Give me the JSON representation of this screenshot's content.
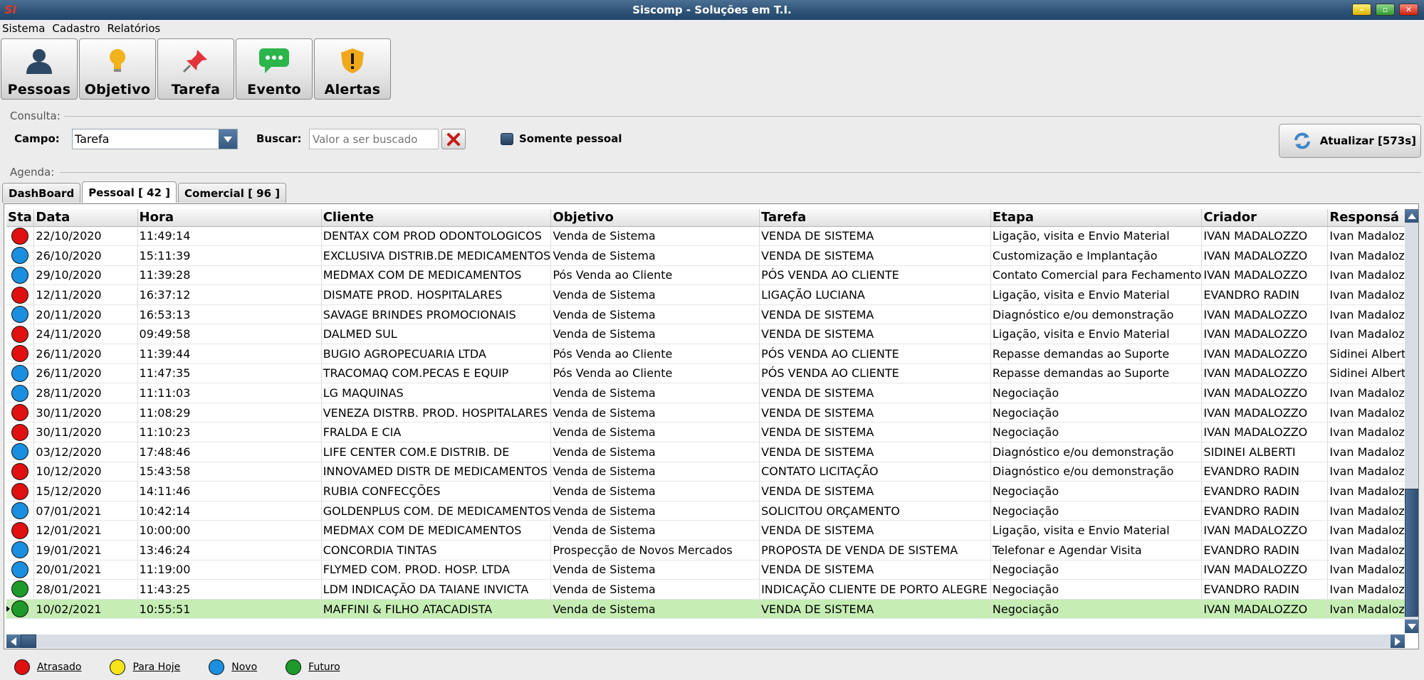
{
  "window": {
    "title": "Siscomp - Soluções em T.I."
  },
  "menu": [
    "Sistema",
    "Cadastro",
    "Relatórios"
  ],
  "toolbar": [
    {
      "label": "Pessoas",
      "icon": "person-icon"
    },
    {
      "label": "Objetivo",
      "icon": "lightbulb-icon"
    },
    {
      "label": "Tarefa",
      "icon": "pin-icon"
    },
    {
      "label": "Evento",
      "icon": "chat-bubble-icon"
    },
    {
      "label": "Alertas",
      "icon": "shield-alert-icon"
    }
  ],
  "consulta": {
    "group_label": "Consulta:",
    "campo_label": "Campo:",
    "campo_value": "Tarefa",
    "buscar_label": "Buscar:",
    "buscar_placeholder": "Valor a ser buscado",
    "somente_label": "Somente pessoal",
    "refresh_label": "Atualizar [573s]"
  },
  "agenda": {
    "group_label": "Agenda:",
    "tabs": [
      "DashBoard",
      "Pessoal  [ 42 ]",
      "Comercial  [ 96 ]"
    ],
    "active_tab": 1
  },
  "colors": {
    "red": "#e01010",
    "blue": "#1a8fe0",
    "green": "#1d9a2a",
    "yellow": "#f7e51a",
    "selected_row": "#c6eeb4"
  },
  "table": {
    "columns": [
      "Sta",
      "Data",
      "Hora",
      "Cliente",
      "Objetivo",
      "Tarefa",
      "Etapa",
      "Criador",
      "Responsá"
    ],
    "rows": [
      {
        "status": "red",
        "data": "22/10/2020",
        "hora": "11:49:14",
        "cliente": "DENTAX COM PROD ODONTOLOGICOS",
        "objetivo": "Venda de Sistema",
        "tarefa": "VENDA DE SISTEMA",
        "etapa": "Ligação,  visita e Envio Material",
        "criador": "IVAN MADALOZZO",
        "responsavel": "Ivan Madalozzo"
      },
      {
        "status": "blue",
        "data": "26/10/2020",
        "hora": "15:11:39",
        "cliente": "EXCLUSIVA DISTRIB.DE MEDICAMENTOS",
        "objetivo": "Venda de Sistema",
        "tarefa": "VENDA DE SISTEMA",
        "etapa": "Customização e Implantação",
        "criador": "IVAN MADALOZZO",
        "responsavel": "Ivan Madalozzo"
      },
      {
        "status": "blue",
        "data": "29/10/2020",
        "hora": "11:39:28",
        "cliente": "MEDMAX COM DE MEDICAMENTOS",
        "objetivo": "Pós Venda ao Cliente",
        "tarefa": "PÓS VENDA AO CLIENTE",
        "etapa": "Contato Comercial para Fechamento",
        "criador": "IVAN MADALOZZO",
        "responsavel": "Ivan Madalozzo"
      },
      {
        "status": "red",
        "data": "12/11/2020",
        "hora": "16:37:12",
        "cliente": "DISMATE PROD. HOSPITALARES",
        "objetivo": "Venda de Sistema",
        "tarefa": "LIGAÇÃO LUCIANA",
        "etapa": "Ligação,  visita e Envio Material",
        "criador": "EVANDRO RADIN",
        "responsavel": "Ivan Madalozzo"
      },
      {
        "status": "blue",
        "data": "20/11/2020",
        "hora": "16:53:13",
        "cliente": "SAVAGE BRINDES PROMOCIONAIS",
        "objetivo": "Venda de Sistema",
        "tarefa": "VENDA DE SISTEMA",
        "etapa": "Diagnóstico e/ou  demonstração",
        "criador": "IVAN MADALOZZO",
        "responsavel": "Ivan Madalozzo"
      },
      {
        "status": "red",
        "data": "24/11/2020",
        "hora": "09:49:58",
        "cliente": "DALMED SUL",
        "objetivo": "Venda de Sistema",
        "tarefa": "VENDA DE SISTEMA",
        "etapa": "Ligação,  visita e Envio Material",
        "criador": "IVAN MADALOZZO",
        "responsavel": "Ivan Madalozzo"
      },
      {
        "status": "red",
        "data": "26/11/2020",
        "hora": "11:39:44",
        "cliente": "BUGIO   AGROPECUARIA LTDA",
        "objetivo": "Pós Venda ao Cliente",
        "tarefa": "PÓS VENDA AO CLIENTE",
        "etapa": "Repasse demandas ao Suporte",
        "criador": "IVAN MADALOZZO",
        "responsavel": "Sidinei  Alberti"
      },
      {
        "status": "blue",
        "data": "26/11/2020",
        "hora": "11:47:35",
        "cliente": "TRACOMAQ    COM.PECAS E EQUIP",
        "objetivo": "Pós Venda ao Cliente",
        "tarefa": "PÓS VENDA AO CLIENTE",
        "etapa": "Repasse demandas ao Suporte",
        "criador": "IVAN MADALOZZO",
        "responsavel": "Sidinei  Alberti"
      },
      {
        "status": "blue",
        "data": "28/11/2020",
        "hora": "11:11:03",
        "cliente": "LG MAQUINAS",
        "objetivo": "Venda de Sistema",
        "tarefa": "VENDA DE SISTEMA",
        "etapa": "Negociação",
        "criador": "IVAN MADALOZZO",
        "responsavel": "Ivan Madalozzo"
      },
      {
        "status": "red",
        "data": "30/11/2020",
        "hora": "11:08:29",
        "cliente": "VENEZA DISTRB. PROD. HOSPITALARES",
        "objetivo": "Venda de Sistema",
        "tarefa": "VENDA DE SISTEMA",
        "etapa": "Negociação",
        "criador": "IVAN MADALOZZO",
        "responsavel": "Ivan Madalozzo"
      },
      {
        "status": "red",
        "data": "30/11/2020",
        "hora": "11:10:23",
        "cliente": "FRALDA E CIA",
        "objetivo": "Venda de Sistema",
        "tarefa": "VENDA DE SISTEMA",
        "etapa": "Negociação",
        "criador": "IVAN MADALOZZO",
        "responsavel": "Ivan Madalozzo"
      },
      {
        "status": "blue",
        "data": "03/12/2020",
        "hora": "17:48:46",
        "cliente": "LIFE CENTER COM.E DISTRIB. DE",
        "objetivo": "Venda de Sistema",
        "tarefa": "VENDA DE SISTEMA",
        "etapa": "Diagnóstico e/ou  demonstração",
        "criador": "SIDINEI  ALBERTI",
        "responsavel": "Ivan Madalozzo"
      },
      {
        "status": "red",
        "data": "10/12/2020",
        "hora": "15:43:58",
        "cliente": "INNOVAMED DISTR DE MEDICAMENTOS",
        "objetivo": "Venda de Sistema",
        "tarefa": "CONTATO LICITAÇÃO",
        "etapa": "Diagnóstico e/ou  demonstração",
        "criador": "EVANDRO RADIN",
        "responsavel": "Ivan Madalozzo"
      },
      {
        "status": "red",
        "data": "15/12/2020",
        "hora": "14:11:46",
        "cliente": "RUBIA CONFECÇÕES",
        "objetivo": "Venda de Sistema",
        "tarefa": "VENDA DE SISTEMA",
        "etapa": "Negociação",
        "criador": "EVANDRO RADIN",
        "responsavel": "Ivan Madalozzo"
      },
      {
        "status": "blue",
        "data": "07/01/2021",
        "hora": "10:42:14",
        "cliente": "GOLDENPLUS COM. DE MEDICAMENTOS",
        "objetivo": "Venda de Sistema",
        "tarefa": "SOLICITOU ORÇAMENTO",
        "etapa": "Negociação",
        "criador": "EVANDRO RADIN",
        "responsavel": "Ivan Madalozzo"
      },
      {
        "status": "red",
        "data": "12/01/2021",
        "hora": "10:00:00",
        "cliente": "MEDMAX COM DE MEDICAMENTOS",
        "objetivo": "Venda de Sistema",
        "tarefa": "VENDA DE SISTEMA",
        "etapa": "Ligação,  visita e Envio Material",
        "criador": "IVAN MADALOZZO",
        "responsavel": "Ivan Madalozzo"
      },
      {
        "status": "blue",
        "data": "19/01/2021",
        "hora": "13:46:24",
        "cliente": "CONCORDIA TINTAS",
        "objetivo": "Prospecção de Novos Mercados",
        "tarefa": "PROPOSTA DE VENDA DE SISTEMA",
        "etapa": "Telefonar e Agendar Visita",
        "criador": "EVANDRO RADIN",
        "responsavel": "Ivan Madalozzo"
      },
      {
        "status": "blue",
        "data": "20/01/2021",
        "hora": "11:19:00",
        "cliente": "FLYMED COM. PROD.  HOSP. LTDA",
        "objetivo": "Venda de Sistema",
        "tarefa": "VENDA DE SISTEMA",
        "etapa": "Negociação",
        "criador": "IVAN MADALOZZO",
        "responsavel": "Ivan Madalozzo"
      },
      {
        "status": "green",
        "data": "28/01/2021",
        "hora": "11:43:25",
        "cliente": "LDM INDICAÇÃO DA TAIANE INVICTA",
        "objetivo": "Venda de Sistema",
        "tarefa": "INDICAÇÃO CLIENTE DE PORTO ALEGRE",
        "etapa": "Negociação",
        "criador": "EVANDRO RADIN",
        "responsavel": "Ivan Madalozzo"
      },
      {
        "status": "green",
        "data": "10/02/2021",
        "hora": "10:55:51",
        "cliente": "MAFFINI & FILHO ATACADISTA",
        "objetivo": "Venda de Sistema",
        "tarefa": "VENDA DE SISTEMA",
        "etapa": "Negociação",
        "criador": "IVAN MADALOZZO",
        "responsavel": "Ivan Madalozzo",
        "selected": true
      }
    ]
  },
  "legend": [
    {
      "label": "Atrasado",
      "color": "red"
    },
    {
      "label": "Para Hoje",
      "color": "yellow"
    },
    {
      "label": "Novo",
      "color": "blue"
    },
    {
      "label": "Futuro",
      "color": "green"
    }
  ]
}
